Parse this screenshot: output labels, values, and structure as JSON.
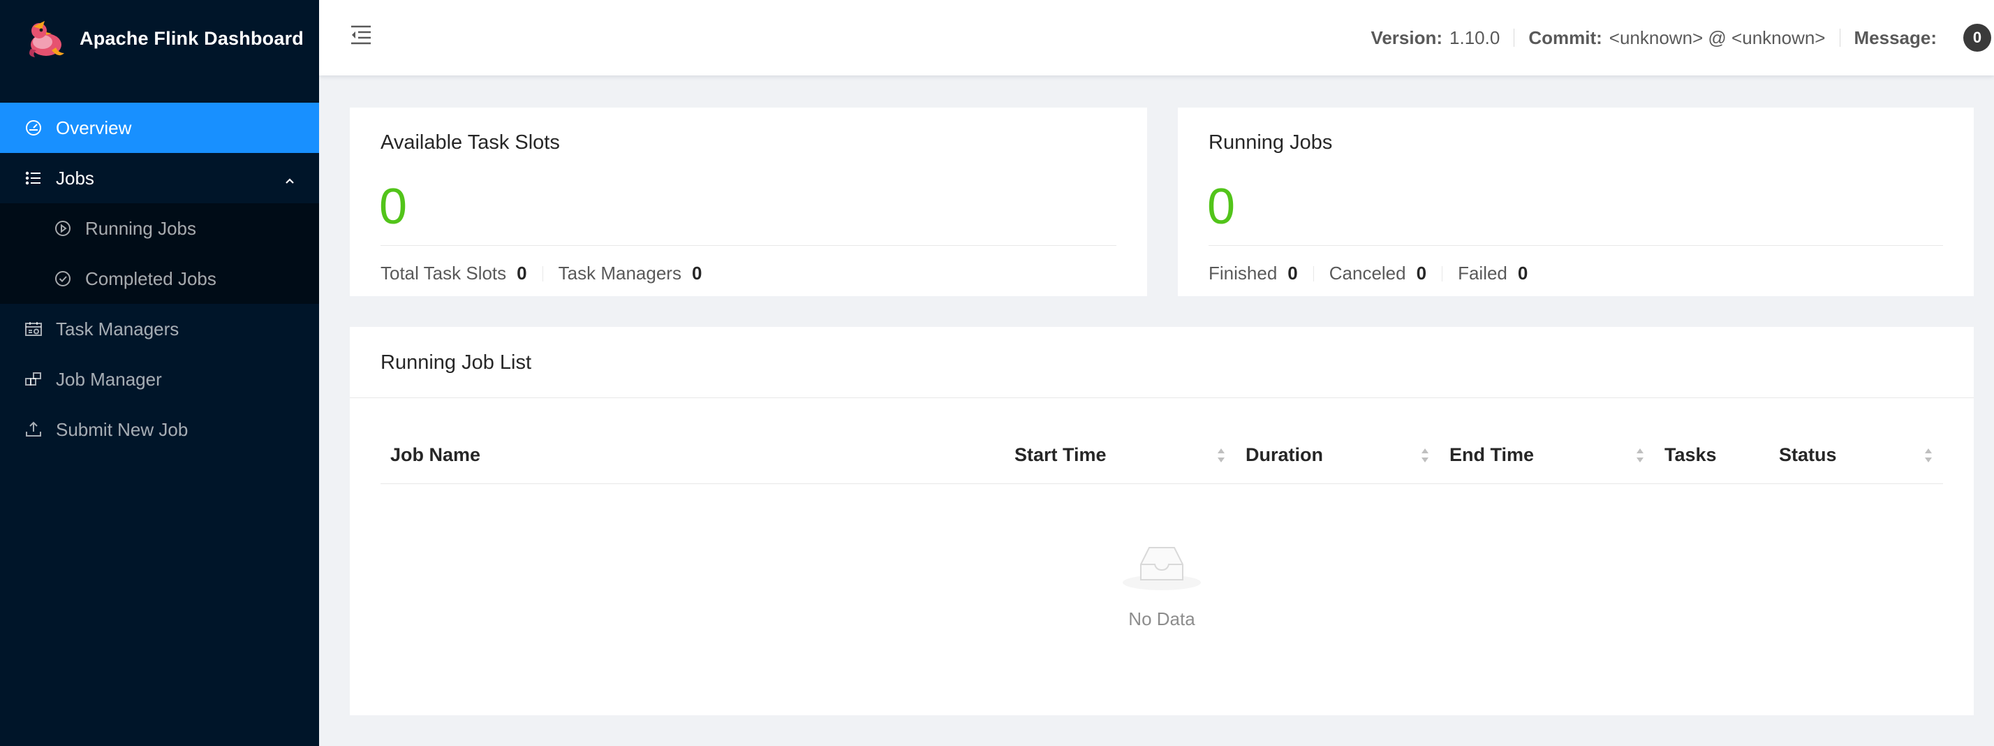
{
  "app": {
    "title": "Apache Flink Dashboard"
  },
  "sidebar": {
    "items": [
      {
        "label": "Overview",
        "icon": "dashboard-icon",
        "active": true
      },
      {
        "label": "Jobs",
        "icon": "unordered-list-icon",
        "expanded": true,
        "children": [
          {
            "label": "Running Jobs",
            "icon": "play-circle-icon"
          },
          {
            "label": "Completed Jobs",
            "icon": "check-circle-icon"
          }
        ]
      },
      {
        "label": "Task Managers",
        "icon": "schedule-icon"
      },
      {
        "label": "Job Manager",
        "icon": "build-icon"
      },
      {
        "label": "Submit New Job",
        "icon": "upload-icon"
      }
    ]
  },
  "header": {
    "version_label": "Version:",
    "version_value": "1.10.0",
    "commit_label": "Commit:",
    "commit_value": "<unknown> @ <unknown>",
    "message_label": "Message:",
    "message_count": "0"
  },
  "cards": {
    "slots": {
      "title": "Available Task Slots",
      "value": "0",
      "stats": [
        {
          "label": "Total Task Slots",
          "value": "0"
        },
        {
          "label": "Task Managers",
          "value": "0"
        }
      ]
    },
    "jobs": {
      "title": "Running Jobs",
      "value": "0",
      "stats": [
        {
          "label": "Finished",
          "value": "0"
        },
        {
          "label": "Canceled",
          "value": "0"
        },
        {
          "label": "Failed",
          "value": "0"
        }
      ]
    }
  },
  "job_list": {
    "title": "Running Job List",
    "columns": [
      "Job Name",
      "Start Time",
      "Duration",
      "End Time",
      "Tasks",
      "Status"
    ],
    "empty_text": "No Data"
  },
  "colors": {
    "sidebar": "#001529",
    "active": "#1890ff",
    "accent_green": "#52c41a"
  }
}
